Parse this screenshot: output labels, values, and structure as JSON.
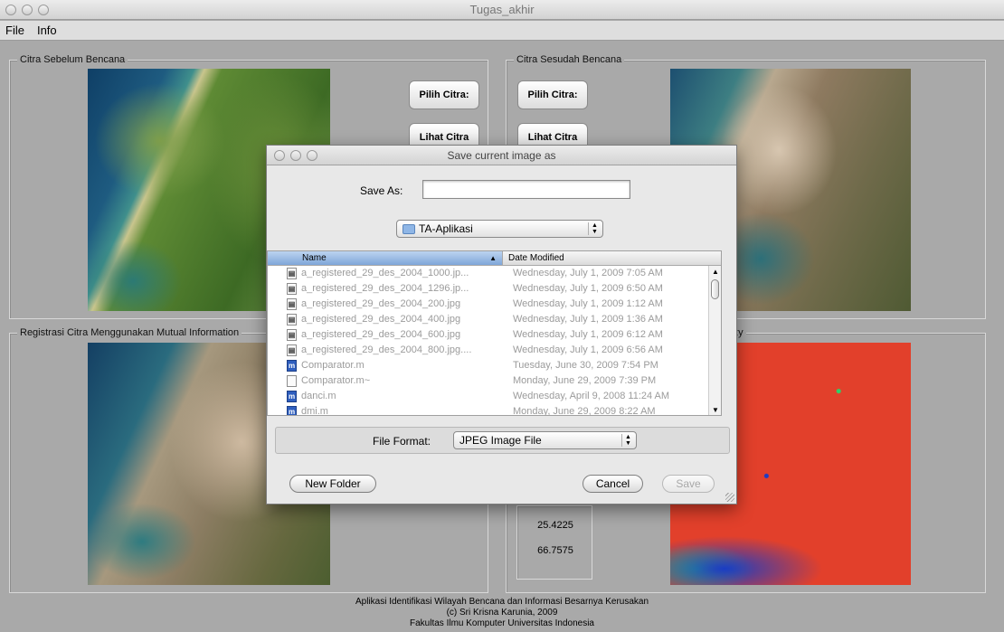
{
  "window": {
    "title": "Tugas_akhir"
  },
  "menubar": {
    "items": [
      "File",
      "Info"
    ]
  },
  "panels": {
    "before": {
      "title": "Citra Sebelum Bencana",
      "pilih_label": "Pilih Citra:",
      "lihat_label": "Lihat Citra"
    },
    "after": {
      "title": "Citra Sesudah Bencana",
      "pilih_label": "Pilih Citra:",
      "lihat_label": "Lihat Citra"
    },
    "registration": {
      "title": "Registrasi Citra Menggunakan Mutual Information"
    },
    "fuzzy": {
      "title": "uzzy",
      "values": [
        "25.4225",
        "66.7575"
      ]
    }
  },
  "footer": {
    "line1": "Aplikasi Identifikasi Wilayah Bencana dan Informasi Besarnya Kerusakan",
    "line2": "(c) Sri Krisna Karunia, 2009",
    "line3": "Fakultas Ilmu Komputer Universitas Indonesia"
  },
  "dialog": {
    "title": "Save current image as",
    "save_as_label": "Save As:",
    "save_as_value": "",
    "location": "TA-Aplikasi",
    "columns": {
      "name": "Name",
      "date": "Date Modified"
    },
    "files": [
      {
        "icon": "image-file-icon",
        "name": "a_registered_29_des_2004_1000.jp...",
        "date": "Wednesday, July 1, 2009 7:05 AM"
      },
      {
        "icon": "image-file-icon",
        "name": "a_registered_29_des_2004_1296.jp...",
        "date": "Wednesday, July 1, 2009 6:50 AM"
      },
      {
        "icon": "image-file-icon",
        "name": "a_registered_29_des_2004_200.jpg",
        "date": "Wednesday, July 1, 2009 1:12 AM"
      },
      {
        "icon": "image-file-icon",
        "name": "a_registered_29_des_2004_400.jpg",
        "date": "Wednesday, July 1, 2009 1:36 AM"
      },
      {
        "icon": "image-file-icon",
        "name": "a_registered_29_des_2004_600.jpg",
        "date": "Wednesday, July 1, 2009 6:12 AM"
      },
      {
        "icon": "image-file-icon",
        "name": "a_registered_29_des_2004_800.jpg....",
        "date": "Wednesday, July 1, 2009 6:56 AM"
      },
      {
        "icon": "m-file-icon",
        "name": "Comparator.m",
        "date": "Tuesday, June 30, 2009 7:54 PM"
      },
      {
        "icon": "blank-file-icon",
        "name": "Comparator.m~",
        "date": "Monday, June 29, 2009 7:39 PM"
      },
      {
        "icon": "m-file-icon",
        "name": "danci.m",
        "date": "Wednesday, April 9, 2008 11:24 AM"
      },
      {
        "icon": "m-file-icon",
        "name": "dmi.m",
        "date": "Monday, June 29, 2009 8:22 AM"
      }
    ],
    "file_format_label": "File Format:",
    "file_format_value": "JPEG Image File",
    "new_folder_label": "New Folder",
    "cancel_label": "Cancel",
    "save_label": "Save"
  }
}
